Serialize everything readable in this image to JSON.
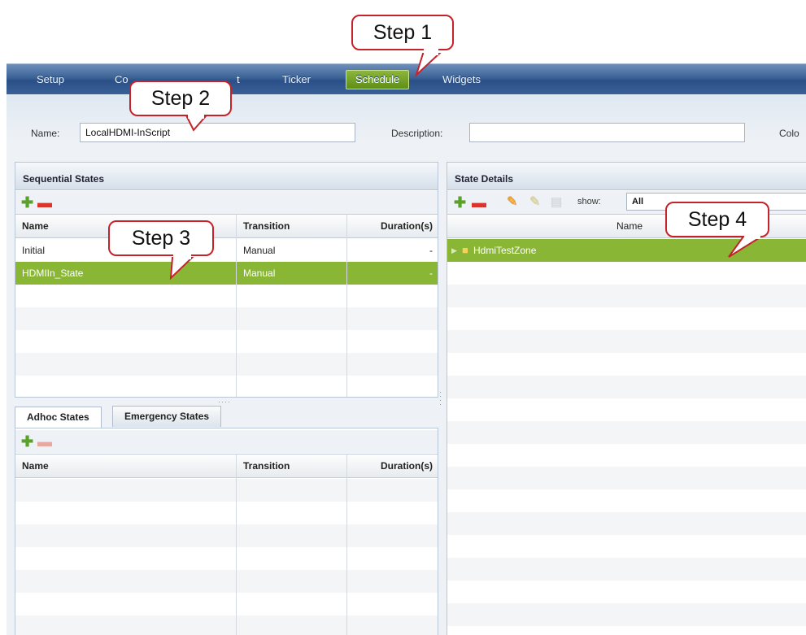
{
  "nav": {
    "items": [
      "Setup",
      "Co",
      "t",
      "Ticker",
      "Schedule",
      "Widgets"
    ],
    "active": "Schedule"
  },
  "form": {
    "name_label": "Name:",
    "name_value": "LocalHDMI-InScript",
    "description_label": "Description:",
    "description_value": "",
    "color_label": "Colo"
  },
  "sequential_states": {
    "title": "Sequential States",
    "columns": [
      "Name",
      "Transition",
      "Duration(s)"
    ],
    "rows": [
      {
        "name": "Initial",
        "transition": "Manual",
        "duration": "-"
      },
      {
        "name": "HDMIIn_State",
        "transition": "Manual",
        "duration": "-",
        "selected": true
      }
    ]
  },
  "adhoc": {
    "tabs": [
      "Adhoc States",
      "Emergency States"
    ],
    "active_tab": "Adhoc States",
    "columns": [
      "Name",
      "Transition",
      "Duration(s)"
    ],
    "rows": []
  },
  "state_details": {
    "title": "State Details",
    "show_label": "show:",
    "show_value": "All",
    "column": "Name",
    "tree": [
      {
        "label": "HdmiTestZone",
        "selected": true
      }
    ]
  },
  "callouts": {
    "step1": "Step 1",
    "step2": "Step 2",
    "step3": "Step 3",
    "step4": "Step 4",
    "color": "#c4232a"
  },
  "colors": {
    "selection": "#8ab635",
    "nav_bar": "#2b5088"
  }
}
